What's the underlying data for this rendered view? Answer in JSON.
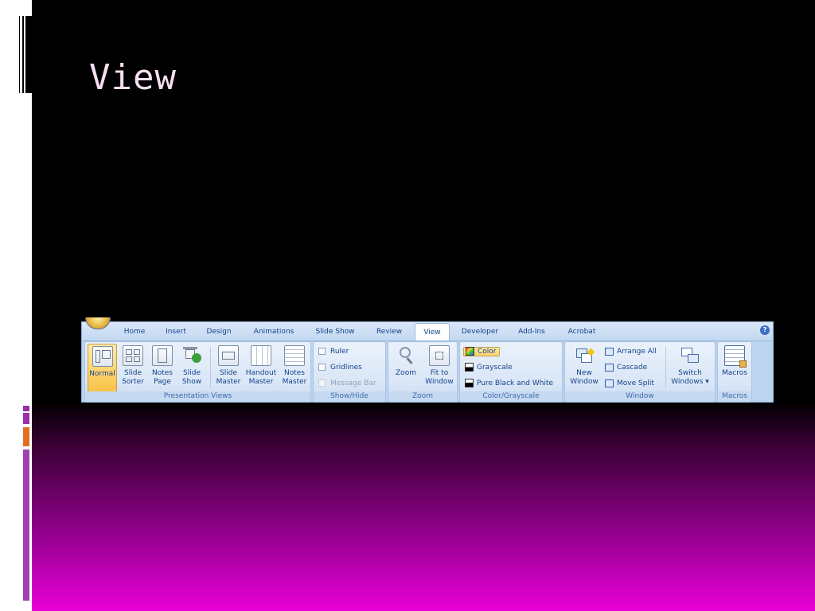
{
  "slide": {
    "title": "View"
  },
  "ribbon": {
    "tabs": [
      "Home",
      "Insert",
      "Design",
      "Animations",
      "Slide Show",
      "Review",
      "View",
      "Developer",
      "Add-Ins",
      "Acrobat"
    ],
    "active_tab": "View",
    "help": "?",
    "groups": {
      "presentation_views": {
        "label": "Presentation Views",
        "normal": "Normal",
        "slide_sorter": [
          "Slide",
          "Sorter"
        ],
        "notes_page": [
          "Notes",
          "Page"
        ],
        "slide_show": [
          "Slide",
          "Show"
        ],
        "slide_master": [
          "Slide",
          "Master"
        ],
        "handout_master": [
          "Handout",
          "Master"
        ],
        "notes_master": [
          "Notes",
          "Master"
        ]
      },
      "show_hide": {
        "label": "Show/Hide",
        "ruler": "Ruler",
        "gridlines": "Gridlines",
        "message_bar": "Message Bar"
      },
      "zoom": {
        "label": "Zoom",
        "zoom": "Zoom",
        "fit_to_window": [
          "Fit to",
          "Window"
        ]
      },
      "color_grayscale": {
        "label": "Color/Grayscale",
        "color": "Color",
        "grayscale": "Grayscale",
        "pure_bw": "Pure Black and White"
      },
      "window": {
        "label": "Window",
        "new_window": [
          "New",
          "Window"
        ],
        "arrange_all": "Arrange All",
        "cascade": "Cascade",
        "move_split": "Move Split",
        "switch_windows": [
          "Switch",
          "Windows ▾"
        ]
      },
      "macros": {
        "label": "Macros",
        "macros": "Macros"
      }
    }
  },
  "colors": {
    "ribbon_text": "#15428b",
    "group_label": "#3e6aaa",
    "selected": "#ffd36a",
    "slide_title": "#f7dff0",
    "accent_purple": "#9b30a8",
    "accent_orange": "#e07020"
  }
}
